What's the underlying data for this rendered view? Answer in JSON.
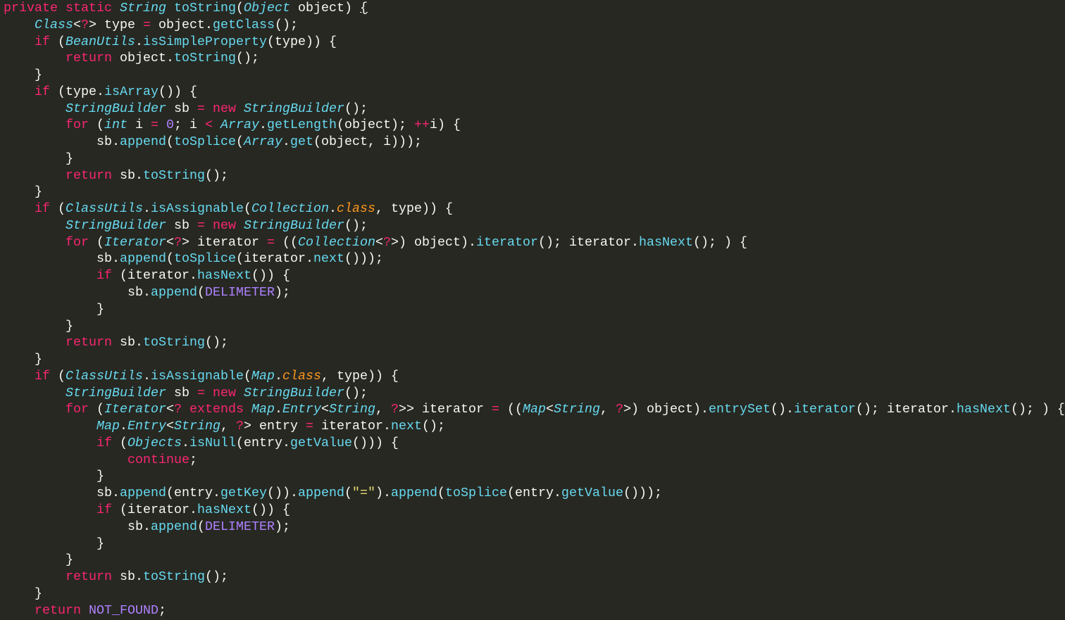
{
  "editor": {
    "theme_colors": {
      "background": "#272822",
      "keyword": "#f92672",
      "type": "#66d9ef",
      "function": "#66d9ef",
      "text": "#f8f8f2",
      "constant": "#ae81ff",
      "class_keyword": "#fd971f",
      "string": "#e6db74"
    },
    "lines": [
      [
        [
          "k",
          "private"
        ],
        [
          "p",
          " "
        ],
        [
          "k",
          "static"
        ],
        [
          "p",
          " "
        ],
        [
          "t",
          "String"
        ],
        [
          "p",
          " "
        ],
        [
          "f",
          "toString"
        ],
        [
          "p",
          "("
        ],
        [
          "t",
          "Object"
        ],
        [
          "p",
          " object) "
        ],
        [
          "u",
          "{"
        ]
      ],
      [
        [
          "p",
          "    "
        ],
        [
          "t",
          "Class"
        ],
        [
          "p",
          "<"
        ],
        [
          "k",
          "?"
        ],
        [
          "p",
          "> type "
        ],
        [
          "k",
          "="
        ],
        [
          "p",
          " object."
        ],
        [
          "f",
          "getClass"
        ],
        [
          "p",
          "();"
        ]
      ],
      [
        [
          "p",
          "    "
        ],
        [
          "k",
          "if"
        ],
        [
          "p",
          " ("
        ],
        [
          "t",
          "BeanUtils"
        ],
        [
          "p",
          "."
        ],
        [
          "f",
          "isSimpleProperty"
        ],
        [
          "p",
          "(type)) {"
        ]
      ],
      [
        [
          "p",
          "        "
        ],
        [
          "k",
          "return"
        ],
        [
          "p",
          " object."
        ],
        [
          "f",
          "toString"
        ],
        [
          "p",
          "();"
        ]
      ],
      [
        [
          "p",
          "    }"
        ]
      ],
      [
        [
          "p",
          "    "
        ],
        [
          "k",
          "if"
        ],
        [
          "p",
          " (type."
        ],
        [
          "f",
          "isArray"
        ],
        [
          "p",
          "()) {"
        ]
      ],
      [
        [
          "p",
          "        "
        ],
        [
          "t",
          "StringBuilder"
        ],
        [
          "p",
          " sb "
        ],
        [
          "k",
          "="
        ],
        [
          "p",
          " "
        ],
        [
          "k",
          "new"
        ],
        [
          "p",
          " "
        ],
        [
          "t",
          "StringBuilder"
        ],
        [
          "p",
          "();"
        ]
      ],
      [
        [
          "p",
          "        "
        ],
        [
          "k",
          "for"
        ],
        [
          "p",
          " ("
        ],
        [
          "t",
          "int"
        ],
        [
          "p",
          " i "
        ],
        [
          "k",
          "="
        ],
        [
          "p",
          " "
        ],
        [
          "c",
          "0"
        ],
        [
          "p",
          "; i "
        ],
        [
          "k",
          "<"
        ],
        [
          "p",
          " "
        ],
        [
          "t",
          "Array"
        ],
        [
          "p",
          "."
        ],
        [
          "f",
          "getLength"
        ],
        [
          "p",
          "(object); "
        ],
        [
          "k",
          "++"
        ],
        [
          "p",
          "i) {"
        ]
      ],
      [
        [
          "p",
          "            sb."
        ],
        [
          "f",
          "append"
        ],
        [
          "p",
          "("
        ],
        [
          "f",
          "toSplice"
        ],
        [
          "p",
          "("
        ],
        [
          "t",
          "Array"
        ],
        [
          "p",
          "."
        ],
        [
          "f",
          "get"
        ],
        [
          "p",
          "(object, i)));"
        ]
      ],
      [
        [
          "p",
          "        }"
        ]
      ],
      [
        [
          "p",
          "        "
        ],
        [
          "k",
          "return"
        ],
        [
          "p",
          " sb."
        ],
        [
          "f",
          "toString"
        ],
        [
          "p",
          "();"
        ]
      ],
      [
        [
          "p",
          "    }"
        ]
      ],
      [
        [
          "p",
          "    "
        ],
        [
          "k",
          "if"
        ],
        [
          "p",
          " ("
        ],
        [
          "t",
          "ClassUtils"
        ],
        [
          "p",
          "."
        ],
        [
          "f",
          "isAssignable"
        ],
        [
          "p",
          "("
        ],
        [
          "t",
          "Collection"
        ],
        [
          "p",
          "."
        ],
        [
          "o",
          "class"
        ],
        [
          "p",
          ", type)) {"
        ]
      ],
      [
        [
          "p",
          "        "
        ],
        [
          "t",
          "StringBuilder"
        ],
        [
          "p",
          " sb "
        ],
        [
          "k",
          "="
        ],
        [
          "p",
          " "
        ],
        [
          "k",
          "new"
        ],
        [
          "p",
          " "
        ],
        [
          "t",
          "StringBuilder"
        ],
        [
          "p",
          "();"
        ]
      ],
      [
        [
          "p",
          "        "
        ],
        [
          "k",
          "for"
        ],
        [
          "p",
          " ("
        ],
        [
          "t",
          "Iterator"
        ],
        [
          "p",
          "<"
        ],
        [
          "k",
          "?"
        ],
        [
          "p",
          "> iterator "
        ],
        [
          "k",
          "="
        ],
        [
          "p",
          " (("
        ],
        [
          "t",
          "Collection"
        ],
        [
          "p",
          "<"
        ],
        [
          "k",
          "?"
        ],
        [
          "p",
          ">) object)."
        ],
        [
          "f",
          "iterator"
        ],
        [
          "p",
          "(); iterator."
        ],
        [
          "f",
          "hasNext"
        ],
        [
          "p",
          "(); ) {"
        ]
      ],
      [
        [
          "p",
          "            sb."
        ],
        [
          "f",
          "append"
        ],
        [
          "p",
          "("
        ],
        [
          "f",
          "toSplice"
        ],
        [
          "p",
          "(iterator."
        ],
        [
          "f",
          "next"
        ],
        [
          "p",
          "()));"
        ]
      ],
      [
        [
          "p",
          "            "
        ],
        [
          "k",
          "if"
        ],
        [
          "p",
          " (iterator."
        ],
        [
          "f",
          "hasNext"
        ],
        [
          "p",
          "()) {"
        ]
      ],
      [
        [
          "p",
          "                sb."
        ],
        [
          "f",
          "append"
        ],
        [
          "p",
          "("
        ],
        [
          "c",
          "DELIMETER"
        ],
        [
          "p",
          ");"
        ]
      ],
      [
        [
          "p",
          "            }"
        ]
      ],
      [
        [
          "p",
          "        }"
        ]
      ],
      [
        [
          "p",
          "        "
        ],
        [
          "k",
          "return"
        ],
        [
          "p",
          " sb."
        ],
        [
          "f",
          "toString"
        ],
        [
          "p",
          "();"
        ]
      ],
      [
        [
          "p",
          "    }"
        ]
      ],
      [
        [
          "p",
          "    "
        ],
        [
          "k",
          "if"
        ],
        [
          "p",
          " ("
        ],
        [
          "t",
          "ClassUtils"
        ],
        [
          "p",
          "."
        ],
        [
          "f",
          "isAssignable"
        ],
        [
          "p",
          "("
        ],
        [
          "t",
          "Map"
        ],
        [
          "p",
          "."
        ],
        [
          "o",
          "class"
        ],
        [
          "p",
          ", type)) {"
        ]
      ],
      [
        [
          "p",
          "        "
        ],
        [
          "t",
          "StringBuilder"
        ],
        [
          "p",
          " sb "
        ],
        [
          "k",
          "="
        ],
        [
          "p",
          " "
        ],
        [
          "k",
          "new"
        ],
        [
          "p",
          " "
        ],
        [
          "t",
          "StringBuilder"
        ],
        [
          "p",
          "();"
        ]
      ],
      [
        [
          "p",
          "        "
        ],
        [
          "k",
          "for"
        ],
        [
          "p",
          " ("
        ],
        [
          "t",
          "Iterator"
        ],
        [
          "p",
          "<"
        ],
        [
          "k",
          "?"
        ],
        [
          "p",
          " "
        ],
        [
          "k",
          "extends"
        ],
        [
          "p",
          " "
        ],
        [
          "t",
          "Map"
        ],
        [
          "p",
          "."
        ],
        [
          "t",
          "Entry"
        ],
        [
          "p",
          "<"
        ],
        [
          "t",
          "String"
        ],
        [
          "p",
          ", "
        ],
        [
          "k",
          "?"
        ],
        [
          "p",
          ">> iterator "
        ],
        [
          "k",
          "="
        ],
        [
          "p",
          " (("
        ],
        [
          "t",
          "Map"
        ],
        [
          "p",
          "<"
        ],
        [
          "t",
          "String"
        ],
        [
          "p",
          ", "
        ],
        [
          "k",
          "?"
        ],
        [
          "p",
          ">) object)."
        ],
        [
          "f",
          "entrySet"
        ],
        [
          "p",
          "()."
        ],
        [
          "f",
          "iterator"
        ],
        [
          "p",
          "(); iterator."
        ],
        [
          "f",
          "hasNext"
        ],
        [
          "p",
          "(); ) {"
        ]
      ],
      [
        [
          "p",
          "            "
        ],
        [
          "t",
          "Map"
        ],
        [
          "p",
          "."
        ],
        [
          "t",
          "Entry"
        ],
        [
          "p",
          "<"
        ],
        [
          "t",
          "String"
        ],
        [
          "p",
          ", "
        ],
        [
          "k",
          "?"
        ],
        [
          "p",
          "> entry "
        ],
        [
          "k",
          "="
        ],
        [
          "p",
          " iterator."
        ],
        [
          "f",
          "next"
        ],
        [
          "p",
          "();"
        ]
      ],
      [
        [
          "p",
          "            "
        ],
        [
          "k",
          "if"
        ],
        [
          "p",
          " ("
        ],
        [
          "t",
          "Objects"
        ],
        [
          "p",
          "."
        ],
        [
          "f",
          "isNull"
        ],
        [
          "p",
          "(entry."
        ],
        [
          "f",
          "getValue"
        ],
        [
          "p",
          "())) {"
        ]
      ],
      [
        [
          "p",
          "                "
        ],
        [
          "k",
          "continue"
        ],
        [
          "p",
          ";"
        ]
      ],
      [
        [
          "p",
          "            }"
        ]
      ],
      [
        [
          "p",
          "            sb."
        ],
        [
          "f",
          "append"
        ],
        [
          "p",
          "(entry."
        ],
        [
          "f",
          "getKey"
        ],
        [
          "p",
          "())."
        ],
        [
          "f",
          "append"
        ],
        [
          "p",
          "("
        ],
        [
          "s",
          "\"=\""
        ],
        [
          "p",
          ")."
        ],
        [
          "f",
          "append"
        ],
        [
          "p",
          "("
        ],
        [
          "f",
          "toSplice"
        ],
        [
          "p",
          "(entry."
        ],
        [
          "f",
          "getValue"
        ],
        [
          "p",
          "()));"
        ]
      ],
      [
        [
          "p",
          "            "
        ],
        [
          "k",
          "if"
        ],
        [
          "p",
          " (iterator."
        ],
        [
          "f",
          "hasNext"
        ],
        [
          "p",
          "()) {"
        ]
      ],
      [
        [
          "p",
          "                sb."
        ],
        [
          "f",
          "append"
        ],
        [
          "p",
          "("
        ],
        [
          "c",
          "DELIMETER"
        ],
        [
          "p",
          ");"
        ]
      ],
      [
        [
          "p",
          "            }"
        ]
      ],
      [
        [
          "p",
          "        }"
        ]
      ],
      [
        [
          "p",
          "        "
        ],
        [
          "k",
          "return"
        ],
        [
          "p",
          " sb."
        ],
        [
          "f",
          "toString"
        ],
        [
          "p",
          "();"
        ]
      ],
      [
        [
          "p",
          "    }"
        ]
      ],
      [
        [
          "p",
          "    "
        ],
        [
          "k",
          "return"
        ],
        [
          "p",
          " "
        ],
        [
          "c",
          "NOT_FOUND"
        ],
        [
          "p",
          ";"
        ]
      ]
    ]
  }
}
